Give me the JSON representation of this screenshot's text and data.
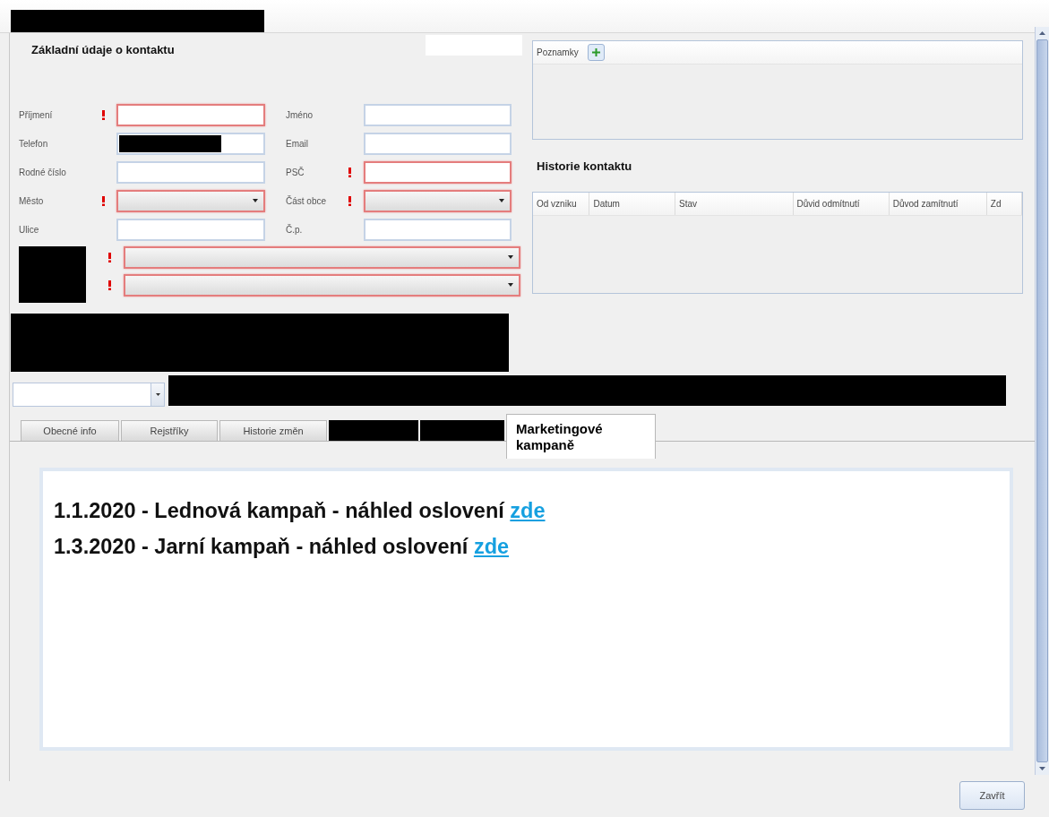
{
  "contact_form": {
    "title": "Základní údaje o kontaktu",
    "fields": [
      {
        "label": "Příjmení",
        "required": true,
        "kind": "text",
        "redacted": false
      },
      {
        "label": "Jméno",
        "required": false,
        "kind": "text",
        "redacted": false
      },
      {
        "label": "Telefon",
        "required": false,
        "kind": "text",
        "redacted": true
      },
      {
        "label": "Email",
        "required": false,
        "kind": "text",
        "redacted": false
      },
      {
        "label": "Rodné číslo",
        "required": false,
        "kind": "text",
        "redacted": false
      },
      {
        "label": "PSČ",
        "required": true,
        "kind": "text",
        "redacted": false
      },
      {
        "label": "Město",
        "required": true,
        "kind": "select",
        "redacted": false
      },
      {
        "label": "Část obce",
        "required": true,
        "kind": "select",
        "redacted": false
      },
      {
        "label": "Ulice",
        "required": false,
        "kind": "text",
        "redacted": false
      },
      {
        "label": "Č.p.",
        "required": false,
        "kind": "text",
        "redacted": false
      }
    ],
    "wide_selects": [
      {
        "required": true
      },
      {
        "required": true
      }
    ]
  },
  "notes": {
    "title": "Poznamky"
  },
  "history": {
    "title": "Historie kontaktu",
    "columns": [
      "Od vzniku",
      "Datum",
      "Stav",
      "Důvid odmítnutí",
      "Důvod zamítnutí",
      "Zd"
    ]
  },
  "tabs": [
    {
      "label": "Obecné info",
      "selected": false,
      "redacted": false
    },
    {
      "label": "Rejstříky",
      "selected": false,
      "redacted": false
    },
    {
      "label": "Historie změn",
      "selected": false,
      "redacted": false
    },
    {
      "redacted": true,
      "selected": false
    },
    {
      "redacted": true,
      "selected": false
    },
    {
      "label": "Marketingové kampaně",
      "selected": true,
      "redacted": false
    }
  ],
  "campaigns": [
    {
      "text": "1.1.2020 - Lednová kampaň - náhled oslovení",
      "link": "zde"
    },
    {
      "text": "1.3.2020 - Jarní kampaň - náhled oslovení",
      "link": "zde"
    }
  ],
  "close_button": "Zavřít"
}
